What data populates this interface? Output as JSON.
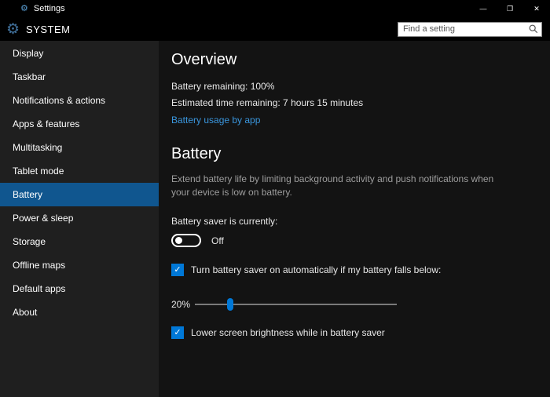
{
  "titlebar": {
    "app_name": "Settings",
    "minimize_glyph": "—",
    "maximize_glyph": "❐",
    "close_glyph": "✕"
  },
  "header": {
    "title": "SYSTEM",
    "search_placeholder": "Find a setting"
  },
  "icons": {
    "gear": "⚙",
    "checkmark": "✓"
  },
  "sidebar": {
    "items": [
      {
        "label": "Display",
        "selected": false
      },
      {
        "label": "Taskbar",
        "selected": false
      },
      {
        "label": "Notifications & actions",
        "selected": false
      },
      {
        "label": "Apps & features",
        "selected": false
      },
      {
        "label": "Multitasking",
        "selected": false
      },
      {
        "label": "Tablet mode",
        "selected": false
      },
      {
        "label": "Battery",
        "selected": true
      },
      {
        "label": "Power & sleep",
        "selected": false
      },
      {
        "label": "Storage",
        "selected": false
      },
      {
        "label": "Offline maps",
        "selected": false
      },
      {
        "label": "Default apps",
        "selected": false
      },
      {
        "label": "About",
        "selected": false
      }
    ]
  },
  "content": {
    "overview": {
      "heading": "Overview",
      "battery_remaining": "Battery remaining: 100%",
      "estimated_time": "Estimated time remaining: 7 hours 15 minutes",
      "usage_link": "Battery usage by app"
    },
    "battery": {
      "heading": "Battery",
      "description": "Extend battery life by limiting background activity and push notifications when your device is low on battery.",
      "saver_label": "Battery saver is currently:",
      "saver_state": "Off",
      "auto_checkbox_label": "Turn battery saver on automatically if my battery falls below:",
      "slider_value": "20%",
      "brightness_checkbox_label": "Lower screen brightness while in battery saver"
    }
  },
  "colors": {
    "accent": "#0078d7",
    "selected_item": "#10568f",
    "link": "#3a96dd",
    "sidebar_bg": "#1f1f1f",
    "content_bg": "#131313",
    "titlebar_bg": "#000000"
  }
}
